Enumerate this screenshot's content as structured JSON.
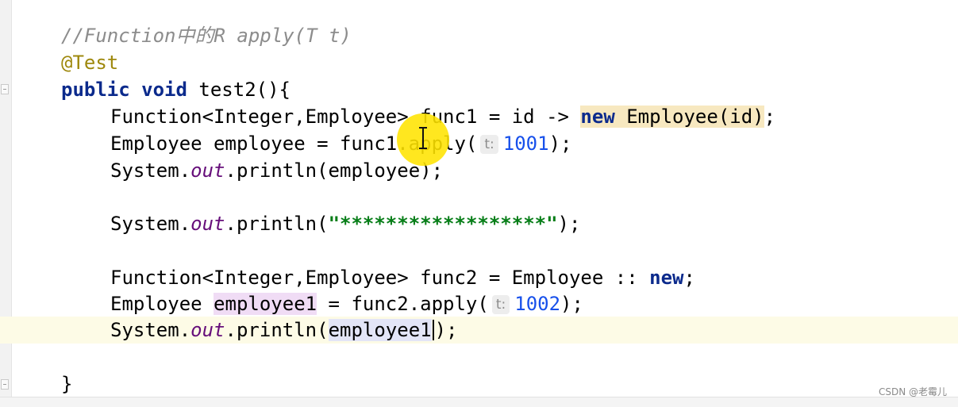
{
  "editor": {
    "lines": [
      {
        "comment": "//Function中的R apply(T t)"
      },
      {
        "annotation": "@Test"
      },
      {
        "kw_public": "public",
        "kw_void": "void",
        "method": " test2(){"
      },
      {
        "a": "Function<Integer,Employee> func1 = id -> ",
        "kw_new": "new",
        "b": " Employee(id)",
        "c": ";"
      },
      {
        "a": "Employee employee = func1.apply(",
        "hint": "t:",
        "num": "1001",
        "b": ");"
      },
      {
        "a": "System.",
        "field": "out",
        "b": ".println(employee);"
      },
      {
        "a": "System.",
        "field": "out",
        "b": ".println(",
        "str": "\"******************\"",
        "c": ");"
      },
      {
        "a": "Function<Integer,Employee> func2 = Employee :: ",
        "kw_new": "new",
        "b": ";"
      },
      {
        "a": "Employee ",
        "var": "employee1",
        "b": " = func2.apply(",
        "hint": "t:",
        "num": "1002",
        "c": ");"
      },
      {
        "a": "System.",
        "field": "out",
        "b": ".println(",
        "var": "employee1",
        "c": ");"
      },
      {
        "brace": "}"
      }
    ]
  },
  "watermark": "CSDN @老霉儿",
  "colors": {
    "keyword": "#0b2a8c",
    "comment": "#8c8c8c",
    "annotation": "#9e880d",
    "static_field": "#660e7a",
    "string": "#067d17",
    "number": "#1750eb",
    "caret_row": "#fdfbe6",
    "mouse_highlight": "#ffe400"
  },
  "icons": [
    "fold-marker-icon",
    "mouse-pointer-highlight-icon",
    "ibeam-cursor-icon"
  ]
}
